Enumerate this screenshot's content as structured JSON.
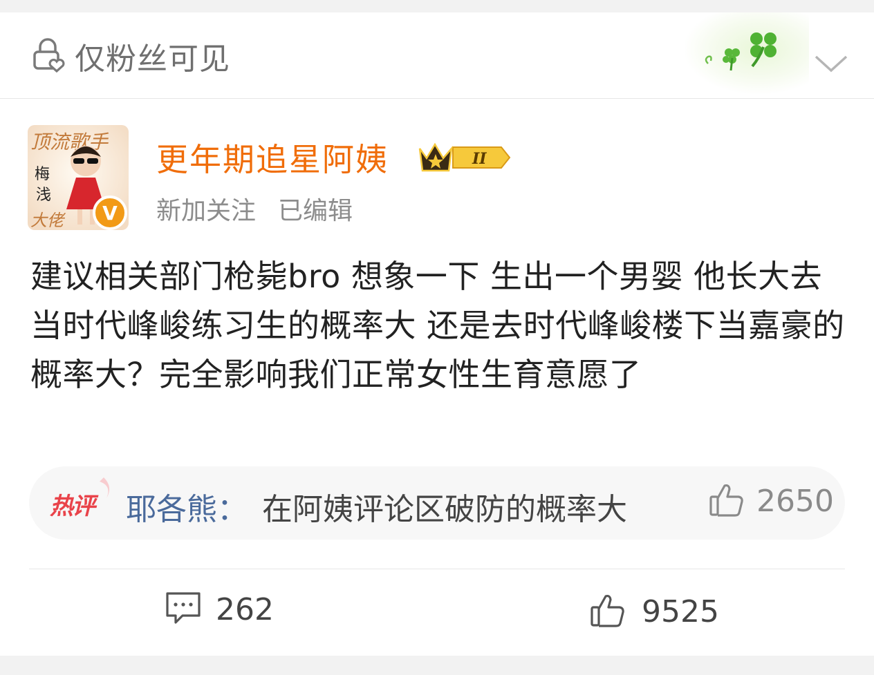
{
  "visibility": {
    "label": "仅粉丝可见",
    "icon": "lock-heart-icon"
  },
  "header_decoration": {
    "icon": "clover-icon"
  },
  "post": {
    "username": "更年期追星阿姨",
    "badge_level": "II",
    "follow_status": "新加关注",
    "edit_status": "已编辑",
    "content": "建议相关部门枪毙bro 想象一下 生出一个男婴 他长大去当时代峰峻练习生的概率大 还是去时代峰峻楼下当嘉豪的概率大？完全影响我们正常女性生育意愿了",
    "avatar_text": [
      "顶流歌手",
      "梅",
      "浅",
      "大佬"
    ]
  },
  "hot_comment": {
    "badge": "热评",
    "user": "耶各熊：",
    "text": "在阿姨评论区破防的概率大",
    "likes": "2650"
  },
  "actions": {
    "comments": "262",
    "likes": "9525"
  },
  "colors": {
    "username": "#f06d0a",
    "hot_user": "#4a6a9b",
    "hot_badge": "#e9434a",
    "verified": "#f29a16"
  }
}
